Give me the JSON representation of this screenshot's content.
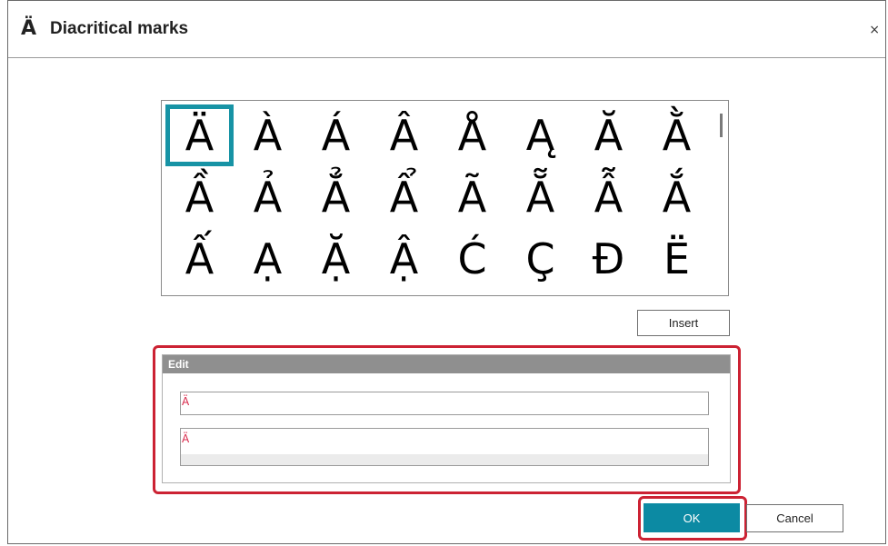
{
  "dialog": {
    "title_icon_char": "Ä",
    "title": "Diacritical marks",
    "close_symbol": "×"
  },
  "character_grid": {
    "selected_index": 0,
    "characters": [
      "Ä",
      "À",
      "Á",
      "Â",
      "Å",
      "Ą",
      "Ă",
      "Ằ",
      "Ầ",
      "Ả",
      "Ẳ",
      "Ẩ",
      "Ã",
      "Ẵ",
      "Ẫ",
      "Ắ",
      "Ấ",
      "Ạ",
      "Ặ",
      "Ậ",
      "Ć",
      "Ç",
      "Đ",
      "Ë"
    ]
  },
  "buttons": {
    "insert_label": "Insert",
    "ok_label": "OK",
    "cancel_label": "Cancel"
  },
  "edit": {
    "header": "Edit",
    "field1_value": "Ä",
    "field2_value": "Ä"
  },
  "colors": {
    "accent": "#0c8aa3",
    "selection_border": "#1793a5",
    "highlight_red": "#cc2233",
    "edit_text": "#d8294b"
  }
}
